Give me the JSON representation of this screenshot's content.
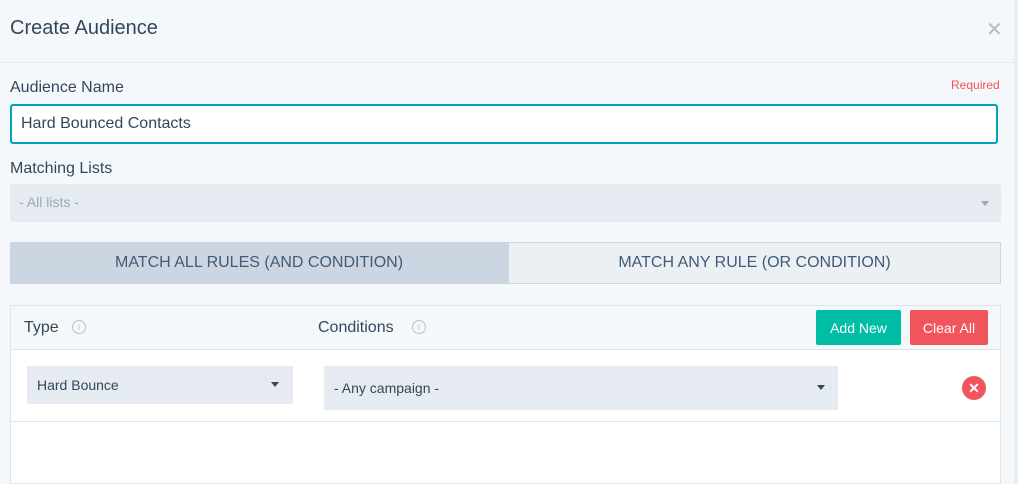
{
  "modal": {
    "title": "Create Audience",
    "close_icon": "close-icon"
  },
  "form": {
    "audience_name_label": "Audience Name",
    "required_label": "Required",
    "audience_name_value": "Hard Bounced Contacts",
    "matching_lists_label": "Matching Lists",
    "matching_lists_placeholder": "- All lists -"
  },
  "match_toggle": {
    "all_label": "MATCH ALL RULES (AND CONDITION)",
    "any_label": "MATCH ANY RULE (OR CONDITION)",
    "selected": "all"
  },
  "rules": {
    "type_header": "Type",
    "conditions_header": "Conditions",
    "add_new_label": "Add New",
    "clear_all_label": "Clear All",
    "rows": [
      {
        "type": "Hard Bounce",
        "condition": "- Any campaign -"
      }
    ]
  },
  "colors": {
    "accent": "#00a4bd",
    "add_button": "#00bda5",
    "danger": "#f2545b",
    "text": "#33475b"
  }
}
